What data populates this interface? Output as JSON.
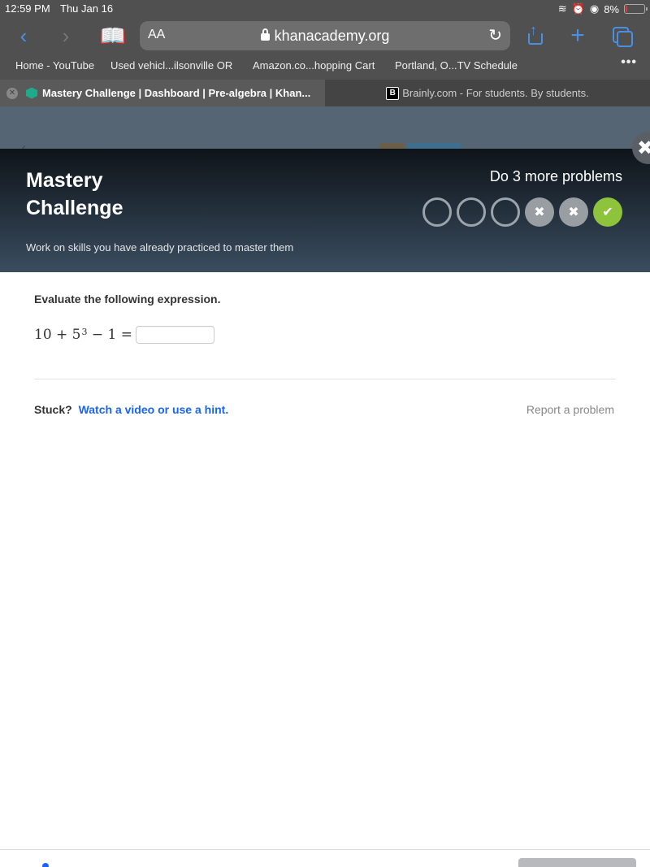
{
  "status_bar": {
    "time": "12:59 PM",
    "date": "Thu Jan 16",
    "battery": "8%",
    "icons": [
      "wifi-icon",
      "alarm-icon",
      "rotation-lock-icon",
      "battery-icon"
    ]
  },
  "toolbar": {
    "text_size_label": "AA",
    "url": "khanacademy.org"
  },
  "bookmarks": [
    {
      "label": "Home - YouTube"
    },
    {
      "label": "Used vehicl...ilsonville OR"
    },
    {
      "label": "Amazon.co...hopping Cart"
    },
    {
      "label": "Portland, O...TV Schedule"
    }
  ],
  "bookmarks_more": "•••",
  "tabs": [
    {
      "title": "Mastery Challenge | Dashboard | Pre-algebra | Khan...",
      "active": true
    },
    {
      "title": "Brainly.com - For students. By students.",
      "active": false
    }
  ],
  "modal": {
    "title_line1": "Mastery",
    "title_line2": "Challenge",
    "subtitle": "Work on skills you have already practiced to master them",
    "progress_label": "Do 3 more problems",
    "progress": [
      {
        "state": "pending"
      },
      {
        "state": "pending"
      },
      {
        "state": "pending"
      },
      {
        "state": "incorrect"
      },
      {
        "state": "incorrect"
      },
      {
        "state": "correct"
      }
    ],
    "colors": {
      "correct": "#8ec43b",
      "incorrect": "#999ea3",
      "link": "#1865f2"
    }
  },
  "question": {
    "prompt": "Evaluate the following expression.",
    "expr_a": "10 + 5",
    "expr_exp": "3",
    "expr_b": " − 1 =",
    "answer_value": ""
  },
  "help": {
    "stuck_label": "Stuck?",
    "hint_link": "Watch a video or use a hint.",
    "report_link": "Report a problem"
  }
}
